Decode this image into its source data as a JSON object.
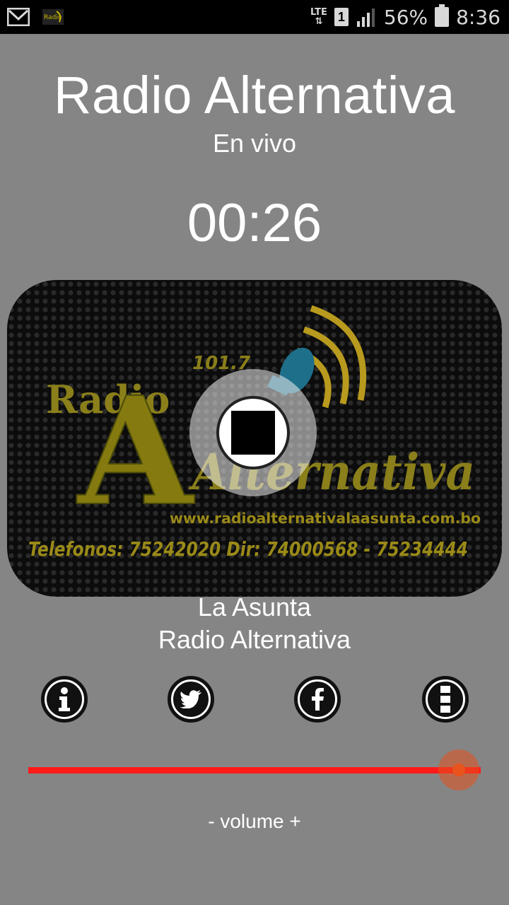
{
  "statusbar": {
    "network": "LTE",
    "sim": "1",
    "battery": "56%",
    "time": "8:36"
  },
  "header": {
    "title": "Radio Alternativa",
    "subtitle": "En vivo"
  },
  "player": {
    "elapsed": "00:26",
    "cover": {
      "frequency": "101.7",
      "name_small": "Radio",
      "name_big": "Alternativa",
      "website": "www.radioalternativalaasunta.com.bo",
      "phones": "Telefonos: 75242020   Dir: 74000568 - 75234444"
    },
    "location": "La Asunta",
    "station": "Radio Alternativa"
  },
  "actions": {
    "info_icon": "info-icon",
    "twitter_icon": "twitter-icon",
    "facebook_icon": "facebook-icon",
    "more_icon": "more-icon"
  },
  "volume": {
    "label": "- volume +",
    "level": 0.975,
    "color": "#ff1a1a"
  }
}
